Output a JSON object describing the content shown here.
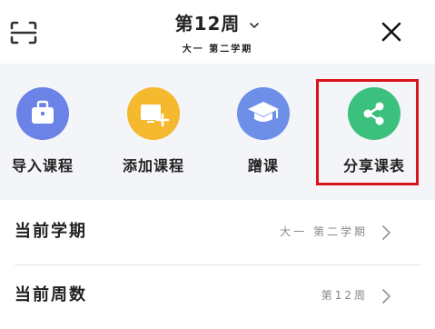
{
  "header": {
    "week_title": "第12周",
    "semester_subtitle": "大一 第二学期",
    "icons": {
      "scan": "scan-icon",
      "dropdown": "chevron-down-icon",
      "close": "close-icon"
    }
  },
  "actions": [
    {
      "label": "导入课程",
      "icon": "briefcase-icon",
      "color": "#6b82e6"
    },
    {
      "label": "添加课程",
      "icon": "add-screen-icon",
      "color": "#f5b92f"
    },
    {
      "label": "蹭课",
      "icon": "graduation-cap-icon",
      "color": "#6d8fe8"
    },
    {
      "label": "分享课表",
      "icon": "share-icon",
      "color": "#3cc07e"
    }
  ],
  "highlight_color": "#d8141b",
  "rows": [
    {
      "label": "当前学期",
      "value": "大一 第二学期"
    },
    {
      "label": "当前周数",
      "value": "第12周"
    }
  ]
}
